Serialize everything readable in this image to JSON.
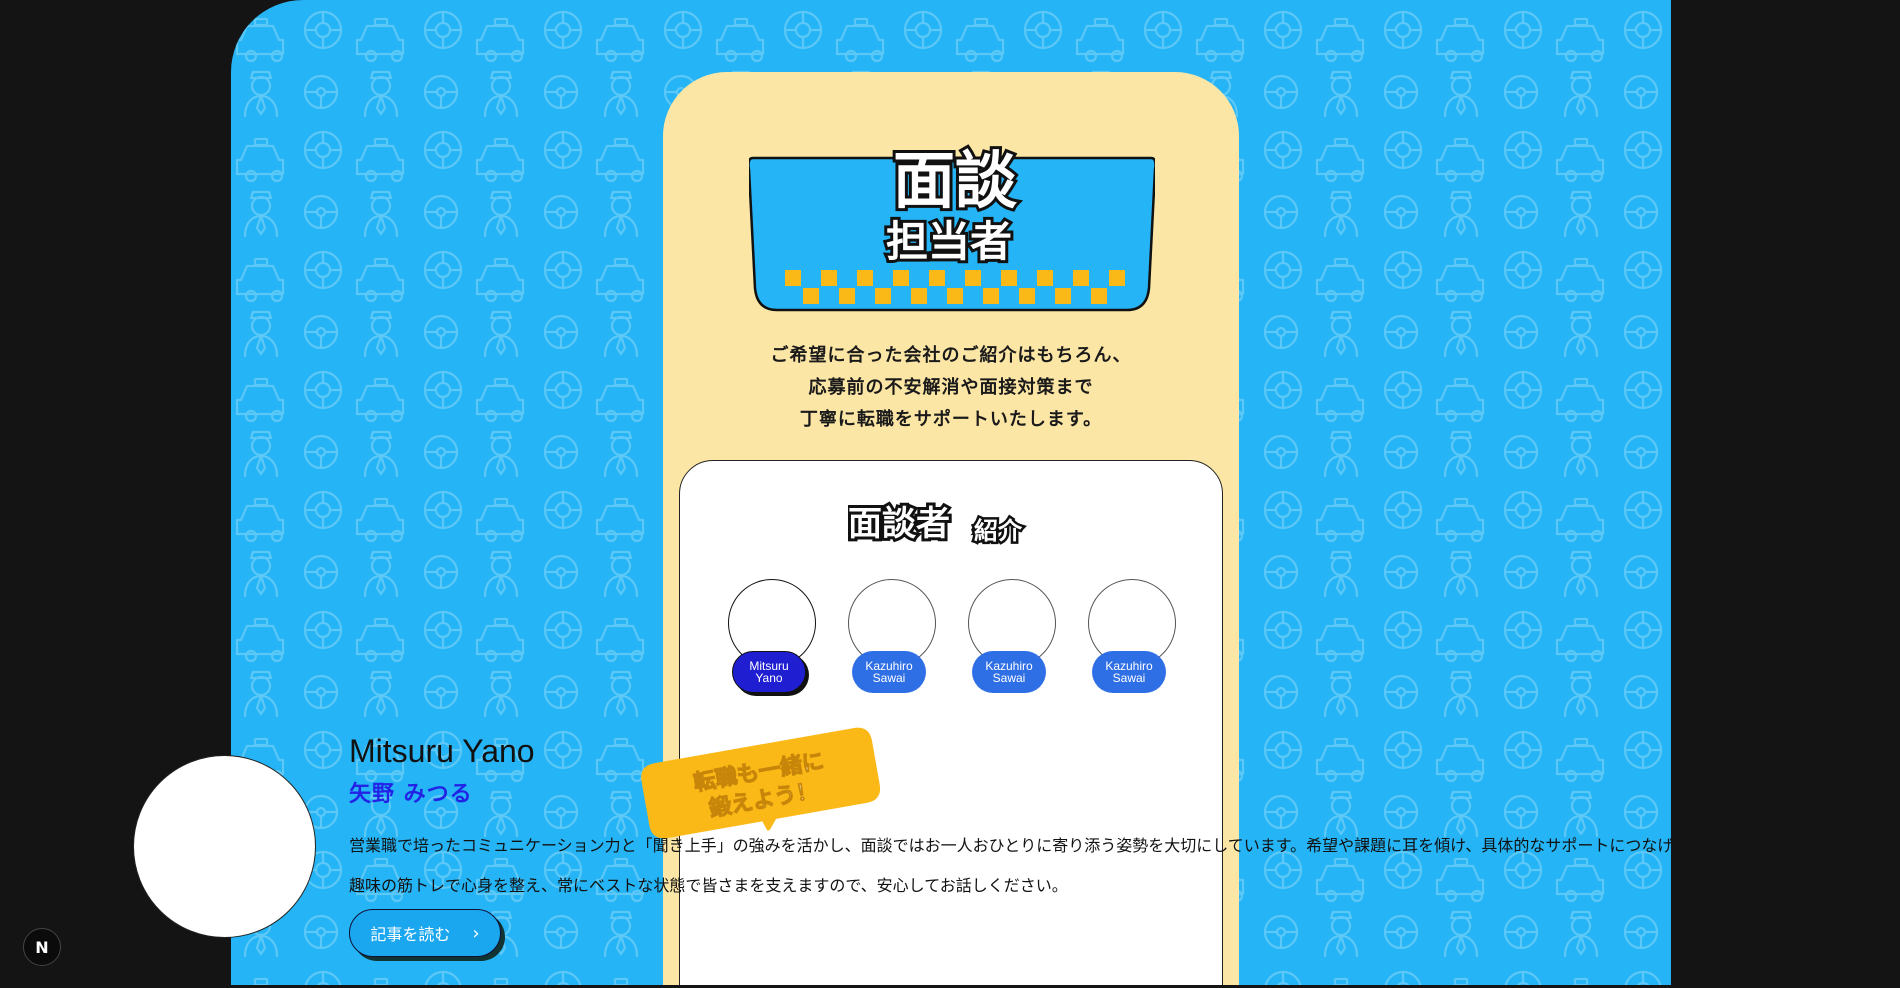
{
  "colors": {
    "background_frame": "#141414",
    "stage_blue": "#25b4f5",
    "card_cream": "#fce6a6",
    "chip_blue": "#2f6fe6",
    "chip_active": "#1f1fd1",
    "accent_yellow": "#fbb917",
    "kana_blue": "#2323e6"
  },
  "banner": {
    "title_line1": "面談",
    "title_line2": "担当者"
  },
  "lead": {
    "line1": "ご希望に合った会社のご紹介はもちろん、",
    "line2": "応募前の不安解消や面接対策まで",
    "line3": "丁寧に転職をサポートいたします。"
  },
  "panel": {
    "title_main": "面談者",
    "title_sub": "紹介"
  },
  "interviewers": [
    {
      "name": "Mitsuru Yano",
      "active": true
    },
    {
      "name": "Kazuhiro Sawai",
      "active": false
    },
    {
      "name": "Kazuhiro Sawai",
      "active": false
    },
    {
      "name": "Kazuhiro Sawai",
      "active": false
    }
  ],
  "bubble": {
    "line1": "転職も一緒に",
    "line2": "鍛えよう！"
  },
  "profile": {
    "name": "Mitsuru Yano",
    "kana": "矢野 みつる",
    "text_line1": "営業職で培ったコミュニケーション力と「聞き上手」の強みを活かし、面談ではお一人おひとりに寄り添う姿勢を大切にしています。希望や課題に耳を傾け、具体的なサポートにつなげ",
    "text_line2": "趣味の筋トレで心身を整え、常にベストな状態で皆さまを支えますので、安心してお話しください。",
    "read_button": "記事を読む"
  },
  "dev_badge": "N"
}
